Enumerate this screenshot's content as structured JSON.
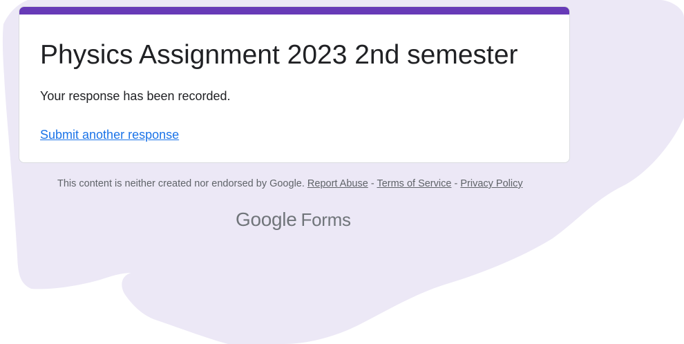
{
  "form": {
    "title": "Physics Assignment 2023 2nd semester",
    "confirmation_message": "Your response has been recorded.",
    "submit_another_link": "Submit another response",
    "accent_color": "#673ab7"
  },
  "footer": {
    "disclaimer": "This content is neither created nor endorsed by Google.",
    "separator": "-",
    "report_abuse": "Report Abuse",
    "terms_of_service": "Terms of Service",
    "privacy_policy": "Privacy Policy"
  },
  "logo": {
    "google": "Google",
    "forms": "Forms"
  },
  "colors": {
    "page_background_blob": "#ece8f6",
    "link": "#1a73e8",
    "muted_text": "#5f6368"
  }
}
